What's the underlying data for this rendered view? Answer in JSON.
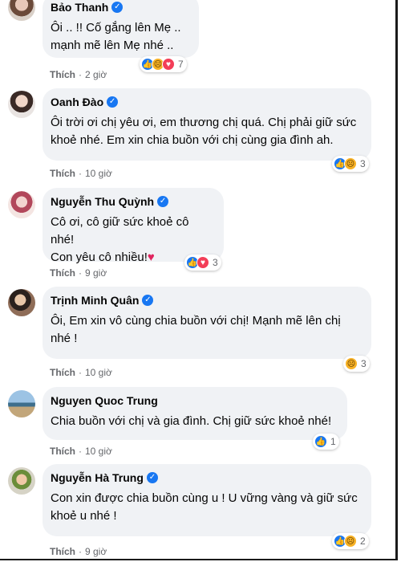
{
  "comments": [
    {
      "name": "Bảo Thanh",
      "lines": "Ôi .. !! Cố gắng lên Mẹ ..\nmạnh mẽ lên Mẹ nhé ..",
      "reactions": [
        "like",
        "sad",
        "love"
      ],
      "count": "7",
      "like_label": "Thích",
      "dot": "·",
      "time": "2 giờ"
    },
    {
      "name": "Oanh Đào",
      "lines": "Ôi trời ơi chị yêu ơi, em thương chị quá. Chị phải giữ sức\nkhoẻ nhé. Em xin chia buồn với chị cùng gia đình ah.",
      "reactions": [
        "like",
        "sad"
      ],
      "count": "3",
      "like_label": "Thích",
      "dot": "·",
      "time": "10 giờ"
    },
    {
      "name": "Nguyễn Thu Quỳnh",
      "lines": "Cô ơi, cô giữ sức khoẻ cô nhé!\nCon yêu cô nhiều!",
      "heart": "♥",
      "reactions": [
        "like",
        "love"
      ],
      "count": "3",
      "like_label": "Thích",
      "dot": "·",
      "time": "9 giờ"
    },
    {
      "name": "Trịnh Minh Quân",
      "lines": "Ôi, Em xin vô cùng chia buồn với chị! Mạnh mẽ lên chị\nnhé !",
      "reactions": [
        "sad"
      ],
      "count": "3",
      "like_label": "Thích",
      "dot": "·",
      "time": "10 giờ"
    },
    {
      "name": "Nguyen Quoc Trung",
      "lines": "Chia buồn với chị và gia đình. Chị giữ sức khoẻ nhé!",
      "reactions": [
        "like"
      ],
      "count": "1",
      "like_label": "Thích",
      "dot": "·",
      "time": "10 giờ"
    },
    {
      "name": "Nguyễn Hà Trung",
      "lines": "Con xin được chia buồn cùng u ! U vững vàng và giữ sức\nkhoẻ u nhé !",
      "reactions": [
        "like",
        "sad"
      ],
      "count": "2",
      "like_label": "Thích",
      "dot": "·",
      "time": "9 giờ"
    }
  ],
  "verified_mark": "✓",
  "colors": {
    "bubble": "#f0f2f5",
    "verified": "#1877f2",
    "meta_text": "#65676b"
  }
}
